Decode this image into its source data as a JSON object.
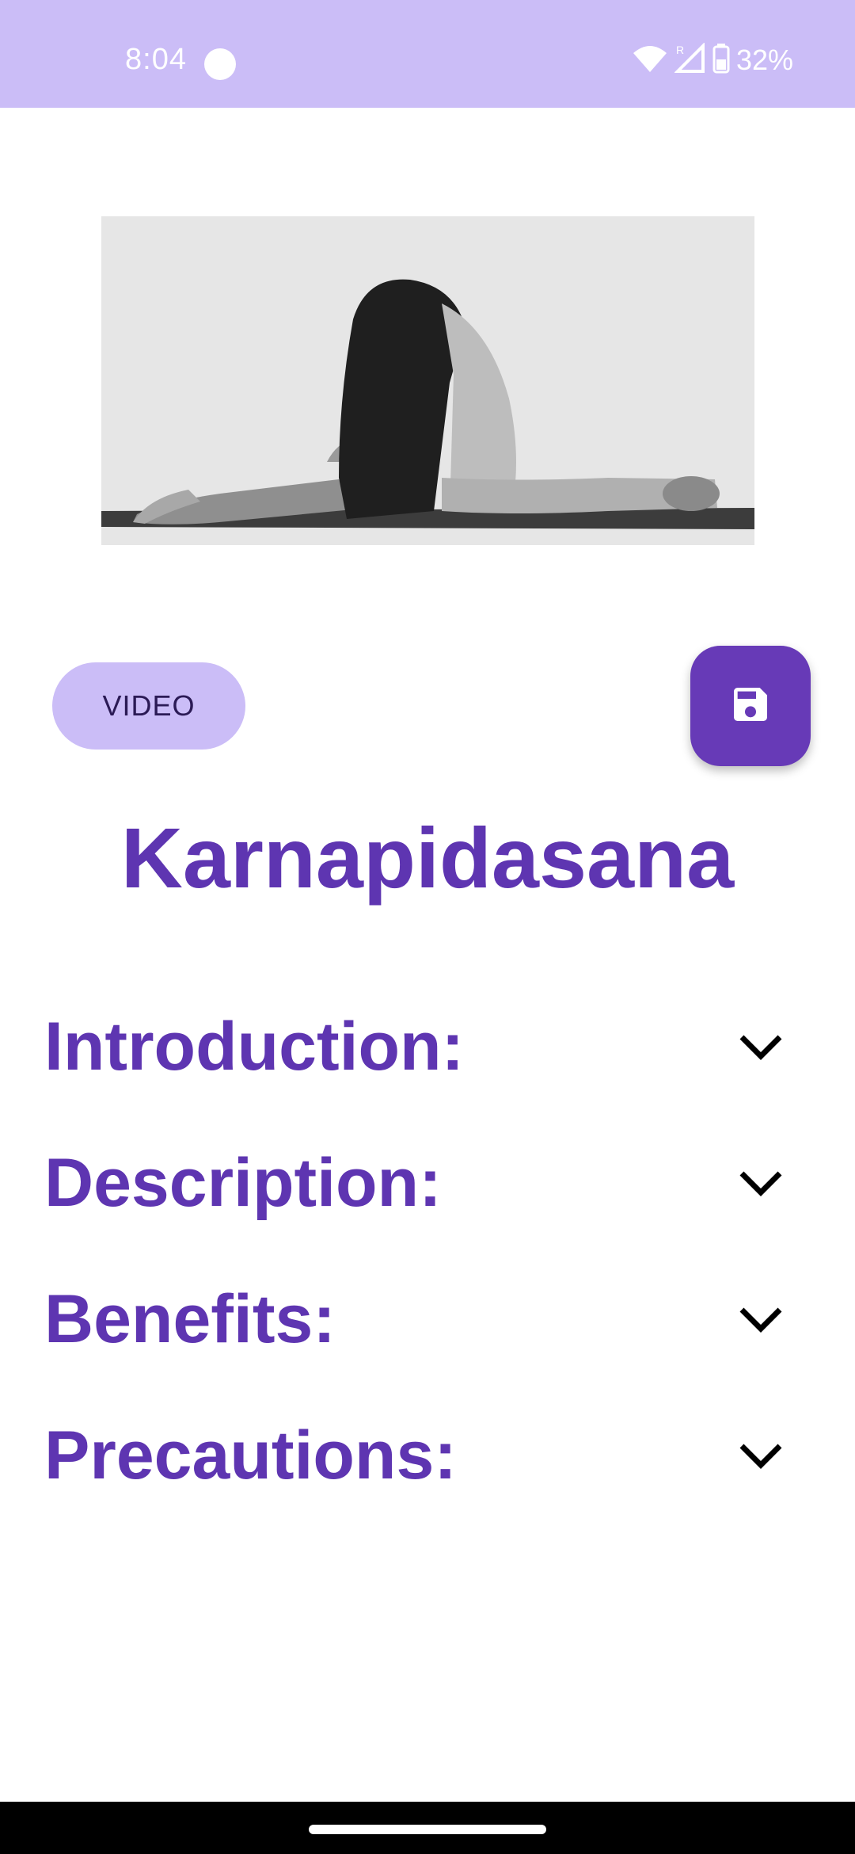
{
  "status_bar": {
    "time": "8:04",
    "battery": "32%",
    "icons": [
      "wifi-icon",
      "signal-icon",
      "battery-icon"
    ],
    "background": "#cbbdf7"
  },
  "pose": {
    "image_icon": "pose-photo",
    "video_label": "VIDEO",
    "save_icon": "save-icon",
    "title": "Karnapidasana"
  },
  "sections": [
    {
      "label": "Introduction:",
      "icon": "chevron-down-icon"
    },
    {
      "label": "Description:",
      "icon": "chevron-down-icon"
    },
    {
      "label": "Benefits:",
      "icon": "chevron-down-icon"
    },
    {
      "label": "Precautions:",
      "icon": "chevron-down-icon"
    }
  ],
  "colors": {
    "accent": "#673ab7",
    "title": "#5e35b1",
    "chip": "#cbbdf7"
  }
}
